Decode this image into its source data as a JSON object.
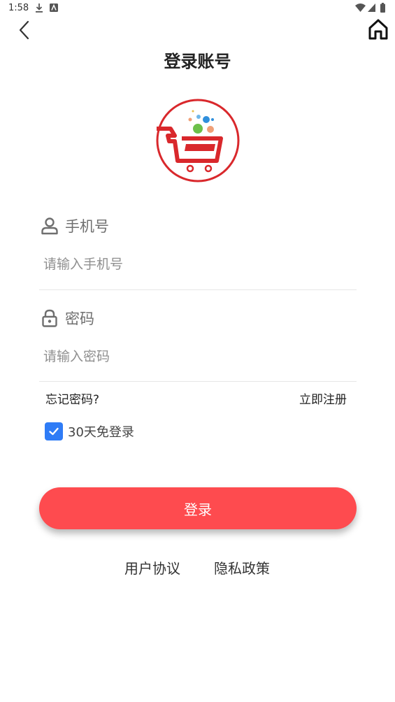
{
  "status_bar": {
    "time": "1:58",
    "left_icons": [
      "download-icon",
      "app-notification-icon"
    ],
    "right_icons": [
      "wifi-icon",
      "signal-icon",
      "battery-icon"
    ]
  },
  "nav": {
    "back_icon": "chevron-left-icon",
    "home_icon": "home-icon"
  },
  "page": {
    "title": "登录账号"
  },
  "logo": {
    "icon": "shopping-cart-logo",
    "brand_color": "#d9282c"
  },
  "phone": {
    "label": "手机号",
    "icon": "user-icon",
    "value": "",
    "placeholder": "请输入手机号"
  },
  "password": {
    "label": "密码",
    "icon": "lock-icon",
    "value": "",
    "placeholder": "请输入密码"
  },
  "links": {
    "forgot_password": "忘记密码?",
    "register": "立即注册"
  },
  "remember": {
    "label": "30天免登录",
    "checked": true,
    "color": "#2f7cf6"
  },
  "login_button": {
    "label": "登录",
    "color": "#fe4b4f"
  },
  "footer": {
    "user_agreement": "用户协议",
    "privacy_policy": "隐私政策"
  }
}
